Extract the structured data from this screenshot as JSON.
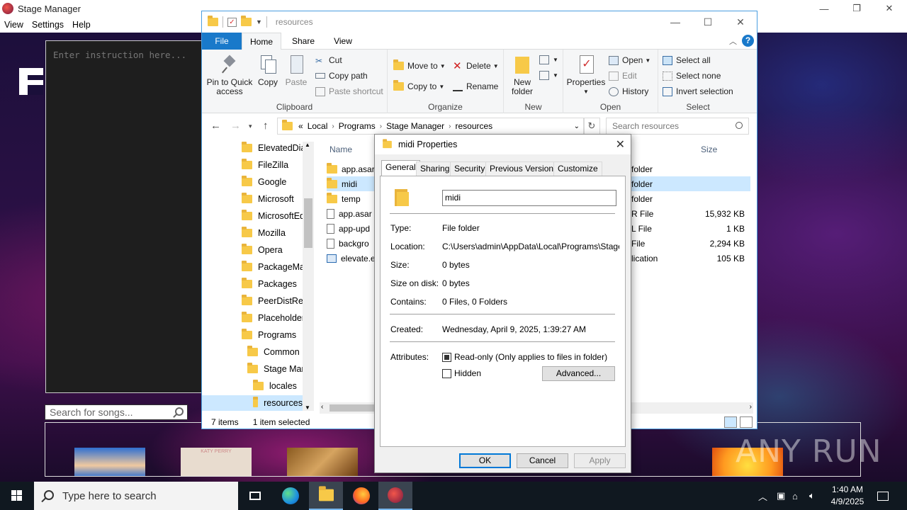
{
  "stage_manager": {
    "title": "Stage Manager",
    "menu": [
      "View",
      "Settings",
      "Help"
    ],
    "instruction_placeholder": "Enter instruction here...",
    "song_search_placeholder": "Search for songs...",
    "album_label": "KATY PERRY"
  },
  "explorer": {
    "title": "resources",
    "tabs": [
      "File",
      "Home",
      "Share",
      "View"
    ],
    "ribbon": {
      "clipboard": {
        "label": "Clipboard",
        "pin": "Pin to Quick access",
        "copy": "Copy",
        "paste": "Paste",
        "cut": "Cut",
        "copy_path": "Copy path",
        "paste_shortcut": "Paste shortcut"
      },
      "organize": {
        "label": "Organize",
        "move_to": "Move to",
        "copy_to": "Copy to",
        "delete": "Delete",
        "rename": "Rename"
      },
      "new": {
        "label": "New",
        "new_folder": "New folder"
      },
      "open": {
        "label": "Open",
        "properties": "Properties",
        "open": "Open",
        "edit": "Edit",
        "history": "History"
      },
      "select": {
        "label": "Select",
        "select_all": "Select all",
        "select_none": "Select none",
        "invert": "Invert selection"
      }
    },
    "address": [
      "«",
      "Local",
      "Programs",
      "Stage Manager",
      "resources"
    ],
    "search_placeholder": "Search resources",
    "nav_items": [
      "ElevatedDiag",
      "FileZilla",
      "Google",
      "Microsoft",
      "MicrosoftEd",
      "Mozilla",
      "Opera",
      "PackageMar",
      "Packages",
      "PeerDistRep",
      "Placeholder",
      "Programs",
      "Common",
      "Stage Man",
      "locales",
      "resources"
    ],
    "columns": {
      "name": "Name",
      "size": "Size"
    },
    "files": [
      {
        "name": "app.asar",
        "type": "folder",
        "size": ""
      },
      {
        "name": "midi",
        "type": "folder",
        "size": ""
      },
      {
        "name": "temp",
        "type": "folder",
        "size": ""
      },
      {
        "name": "app.asar",
        "type": "R File",
        "size": "15,932 KB"
      },
      {
        "name": "app-upd",
        "type": "L File",
        "size": "1 KB"
      },
      {
        "name": "backgro",
        "type": "File",
        "size": "2,294 KB"
      },
      {
        "name": "elevate.e",
        "type": "lication",
        "size": "105 KB"
      }
    ],
    "status": {
      "items": "7 items",
      "selected": "1 item selected"
    }
  },
  "properties": {
    "title": "midi Properties",
    "tabs": [
      "General",
      "Sharing",
      "Security",
      "Previous Versions",
      "Customize"
    ],
    "name": "midi",
    "rows": {
      "type_label": "Type:",
      "type": "File folder",
      "location_label": "Location:",
      "location": "C:\\Users\\admin\\AppData\\Local\\Programs\\Stage M",
      "size_label": "Size:",
      "size": "0 bytes",
      "size_on_disk_label": "Size on disk:",
      "size_on_disk": "0 bytes",
      "contains_label": "Contains:",
      "contains": "0 Files, 0 Folders",
      "created_label": "Created:",
      "created": "Wednesday, April 9, 2025, 1:39:27 AM",
      "attributes_label": "Attributes:"
    },
    "readonly_label": "Read-only (Only applies to files in folder)",
    "hidden_label": "Hidden",
    "advanced": "Advanced...",
    "ok": "OK",
    "cancel": "Cancel",
    "apply": "Apply"
  },
  "taskbar": {
    "search_placeholder": "Type here to search",
    "time": "1:40 AM",
    "date": "4/9/2025"
  },
  "watermark": "ANY RUN"
}
